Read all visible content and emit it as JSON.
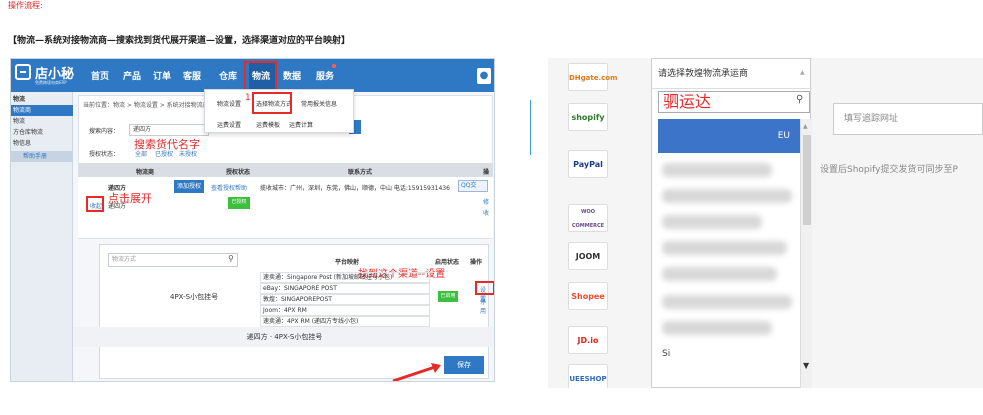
{
  "header_note": "操作流程:",
  "instruction": "【物流—系统对接物流商—搜索找到货代展开渠道—设置，选择渠道对应的平台映射】",
  "left_app": {
    "logo_text": "店小秘",
    "logo_sub": "免费跨境电商ERP",
    "nav": [
      "首页",
      "产品",
      "订单",
      "客服",
      "仓库",
      "物流",
      "数据",
      "服务"
    ],
    "nav_active_index": 5,
    "user_icon": "user-icon",
    "sidebar": [
      "物流",
      "物流商",
      "物流",
      "方仓库物流",
      "物信息"
    ],
    "sidebar_help": "帮助手册",
    "dropdown_items": [
      "物流设置",
      "选择物流方式",
      "常用报关信息",
      "运费设置",
      "运费模板",
      "运费计算"
    ],
    "annotation_1": "1",
    "breadcrumb": "当前位置：物流 > 物流设置 > 系统对接物流商",
    "search_label": "搜索内容：",
    "search_value": "递四方",
    "auth_label": "授权状态：",
    "auth_options": [
      "全部",
      "已授权",
      "未授权"
    ],
    "annotation_search": "搜索货代名字",
    "table_headers": [
      "物流商",
      "授权状态",
      "联系方式",
      "操"
    ],
    "carrier_name": "递四方",
    "carrier_name_2": "递四方",
    "add_auth_btn": "添加授权",
    "view_auth_help": "查看授权帮助",
    "authorized_badge": "已授权",
    "contact": "揽收城市：广州，深圳，东莞，佛山，顺德，中山  电话:15915931436",
    "qq_label": "QQ交",
    "collapse_link": "收起",
    "annotation_expand": "点击展开",
    "edit_link_1": "修",
    "edit_link_2": "收",
    "sub_search_placeholder": "物流方式",
    "sub_headers": [
      "平台映射",
      "启用状态",
      "操作"
    ],
    "annotation_channel": "找到这个渠道--设置",
    "channel_name": "4PX-S小包挂号",
    "mappings": [
      "速卖通：Singapore Post (新加坡邮政挂号小包)",
      "eBay：SINGAPORE POST",
      "敦煌：SINGAPOREPOST",
      "Joom：4PX RM",
      "速卖通：4PX RM (递四方专线小包)"
    ],
    "enabled_badge": "已启用",
    "setting_link": "设置",
    "disable_link": "停用",
    "footer_text": "递四方  ·  4PX-S小包挂号",
    "save_button": "保存"
  },
  "right_app": {
    "brands": [
      "DHgate.com",
      "shopify",
      "PayPal",
      "WOO COMMERCE",
      "JOOM",
      "Shopee",
      "JD.io",
      "UEESHOP"
    ],
    "select_placeholder": "请选择敦煌物流承运商",
    "search_value": "驷运达",
    "highlight_suffix": "EU",
    "tracking_placeholder": "填写追踪网址",
    "hint": "设置后Shopify提交发货可同步至P",
    "partial_text": "Si"
  },
  "colors": {
    "brand_blue": "#2f78c4",
    "annotation_red": "#e62a2a",
    "success_green": "#3cbf3c",
    "select_highlight": "#3b74c9"
  }
}
